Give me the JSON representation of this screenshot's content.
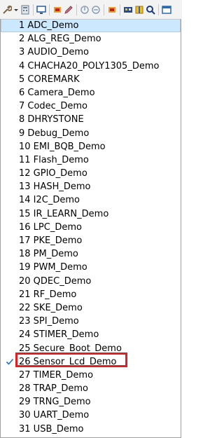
{
  "toolbar": {
    "icons": [
      "wrench-icon",
      "dropdown-arrow-icon",
      "calculator-icon",
      "monitor-icon",
      "chip-icon",
      "pencil-icon",
      "flash-icon",
      "flash-erase-icon",
      "chip-program-icon",
      "board-icon",
      "book-icon",
      "search-icon",
      "window-icon"
    ]
  },
  "menu": {
    "selected_index": 25,
    "highlighted_index": 0,
    "check_glyph": "✓",
    "items": [
      "1 ADC_Demo",
      "2 ALG_REG_Demo",
      "3 AUDIO_Demo",
      "4 CHACHA20_POLY1305_Demo",
      "5 COREMARK",
      "6 Camera_Demo",
      "7 Codec_Demo",
      "8 DHRYSTONE",
      "9 Debug_Demo",
      "10 EMI_BQB_Demo",
      "11 Flash_Demo",
      "12 GPIO_Demo",
      "13 HASH_Demo",
      "14 I2C_Demo",
      "15 IR_LEARN_Demo",
      "16 LPC_Demo",
      "17 PKE_Demo",
      "18 PM_Demo",
      "19 PWM_Demo",
      "20 QDEC_Demo",
      "21 RF_Demo",
      "22 SKE_Demo",
      "23 SPI_Demo",
      "24 STIMER_Demo",
      "25 Secure_Boot_Demo",
      "26 Sensor_Lcd_Demo",
      "27 TIMER_Demo",
      "28 TRAP_Demo",
      "29 TRNG_Demo",
      "30 UART_Demo",
      "31 USB_Demo"
    ]
  },
  "colors": {
    "highlight_bg": "#cce8ff",
    "highlight_border": "#99d1ff",
    "annotation_red": "#e02020",
    "check_blue": "#1a73c8"
  }
}
